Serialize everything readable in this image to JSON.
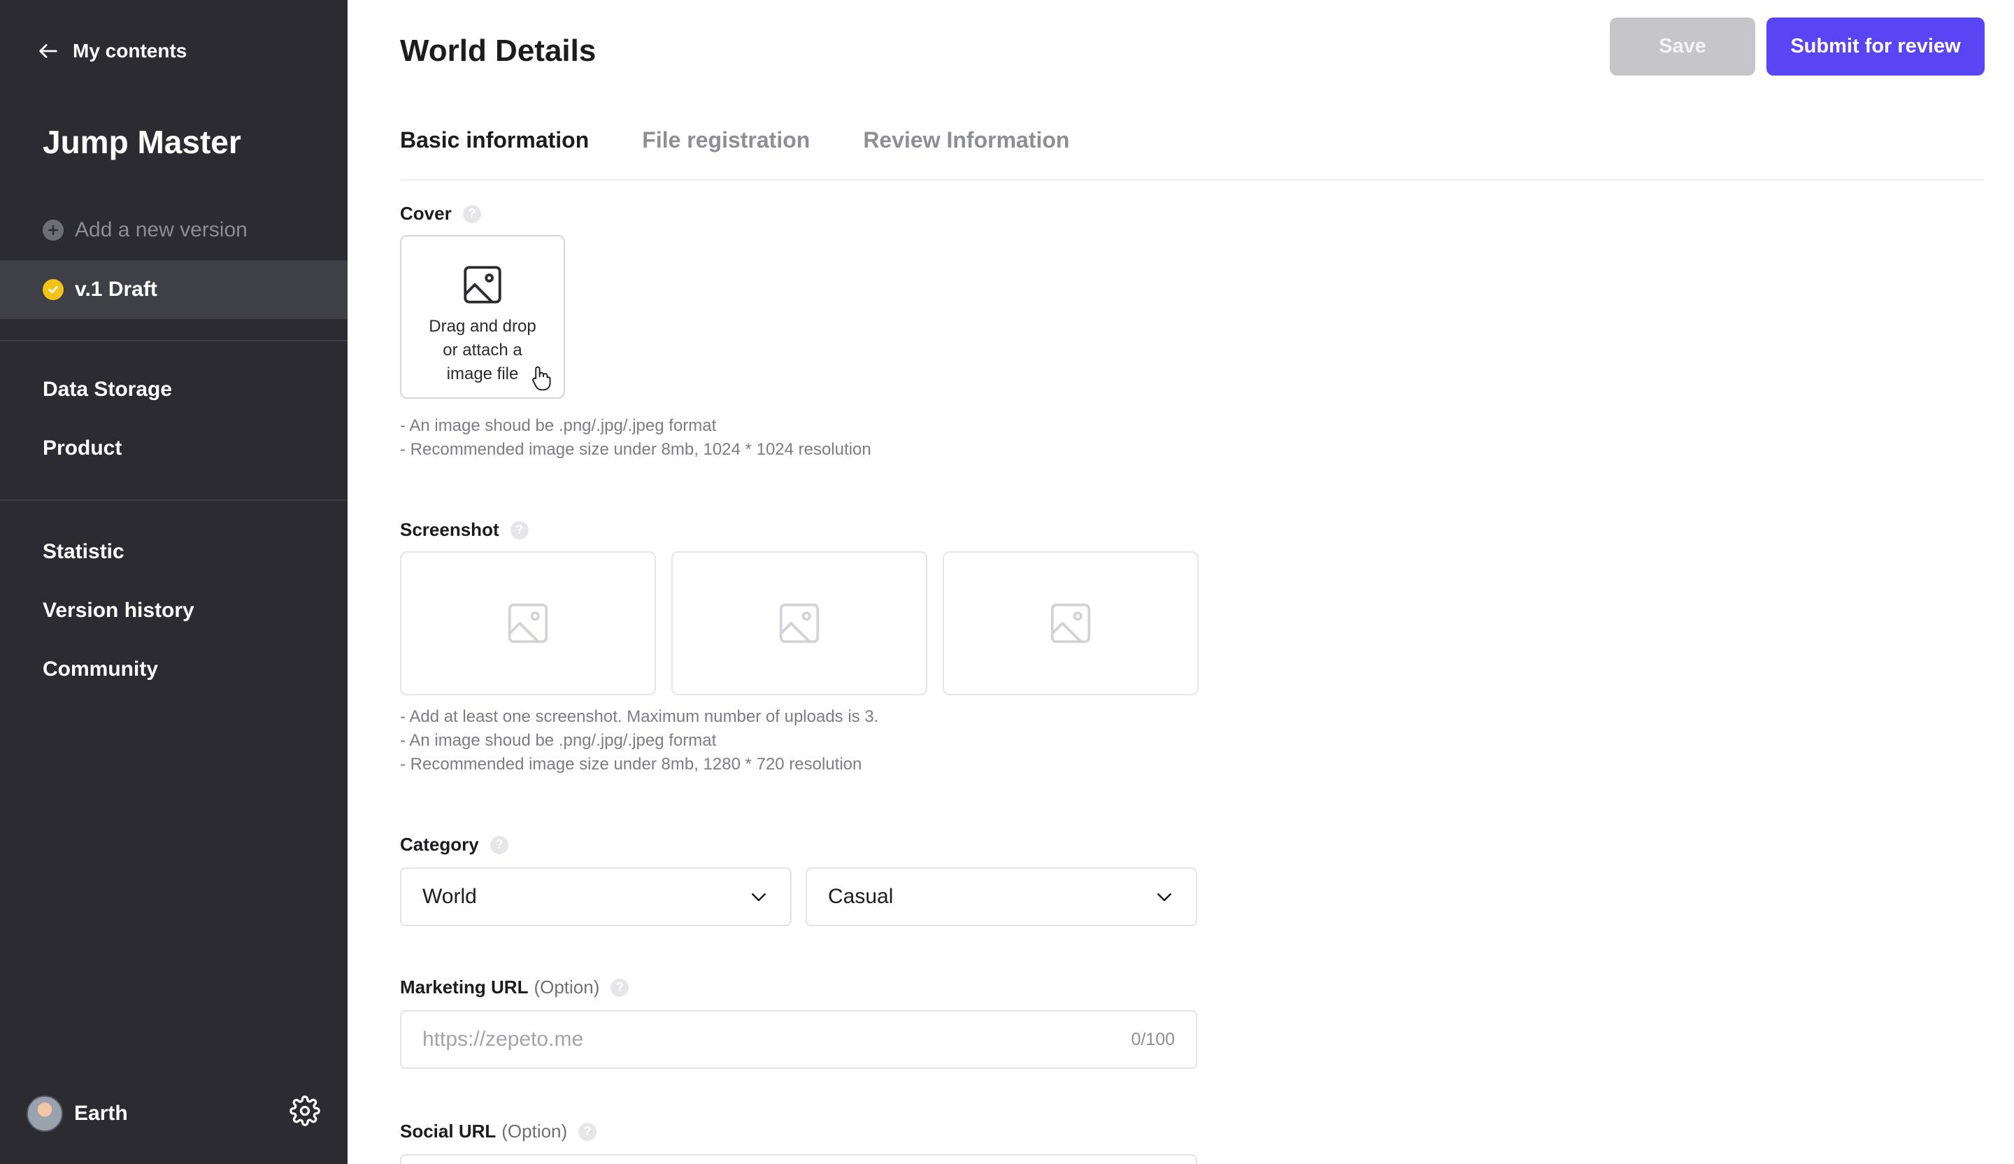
{
  "sidebar": {
    "back_label": "My contents",
    "app_title": "Jump Master",
    "add_version_label": "Add a new version",
    "active_version_label": "v.1 Draft",
    "nav_group_1": [
      "Data Storage",
      "Product"
    ],
    "nav_group_2": [
      "Statistic",
      "Version history",
      "Community"
    ],
    "user_name": "Earth"
  },
  "header": {
    "title": "World Details",
    "save_label": "Save",
    "submit_label": "Submit for review"
  },
  "tabs": [
    {
      "label": "Basic information",
      "active": true
    },
    {
      "label": "File registration",
      "active": false
    },
    {
      "label": "Review Information",
      "active": false
    }
  ],
  "cover": {
    "label": "Cover",
    "dropzone_text": "Drag and drop or attach a image file",
    "hints": [
      "- An image shoud be .png/.jpg/.jpeg format",
      "- Recommended image size under 8mb, 1024 * 1024 resolution"
    ]
  },
  "screenshot": {
    "label": "Screenshot",
    "slot_count": 3,
    "hints": [
      "- Add at least one screenshot. Maximum number of uploads is 3.",
      "- An image shoud be .png/.jpg/.jpeg format",
      "- Recommended image size under 8mb, 1280 * 720 resolution"
    ]
  },
  "category": {
    "label": "Category",
    "primary_value": "World",
    "secondary_value": "Casual"
  },
  "marketing_url": {
    "label": "Marketing URL",
    "option_label": "(Option)",
    "placeholder": "https://zepeto.me",
    "counter": "0/100"
  },
  "social_url": {
    "label": "Social URL",
    "option_label": "(Option)"
  },
  "colors": {
    "sidebar_bg": "#2b2b31",
    "accent": "#5a45f5",
    "draft_badge": "#f5c218"
  }
}
